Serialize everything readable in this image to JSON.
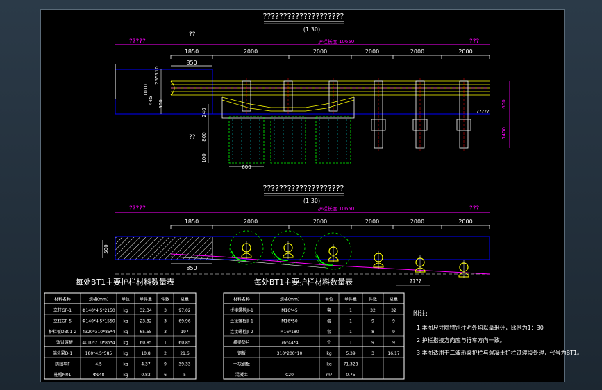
{
  "elevation": {
    "title": "????????????????????",
    "scale": "(1:30)",
    "section_mark_top": "??",
    "section_mark_bottom": "??",
    "left_label": "?????",
    "right_label": "???",
    "total_length": "护栏长度 10650",
    "spans": [
      "1850",
      "2000",
      "2000",
      "2000",
      "2000",
      "2000"
    ],
    "sub_dim": "850",
    "vert_dims": [
      "310",
      "255",
      "1010",
      "445",
      "500",
      "240",
      "800",
      "100"
    ],
    "footing_width": "600",
    "right_dims": [
      "600",
      "1400"
    ],
    "right_note": "?????"
  },
  "plan": {
    "title": "????????????????????",
    "scale": "(1:30)",
    "left_label": "?????",
    "right_label": "???",
    "total_length": "护栏长度 10650",
    "spans": [
      "1850",
      "2000",
      "2000",
      "2000",
      "2000",
      "2000"
    ],
    "sub_dim": "850",
    "height_dim": "500",
    "slope_label": "????"
  },
  "table_left": {
    "title": "每处BT1主要护栏材料数量表",
    "headers": [
      "材料名称",
      "规格(mm)",
      "单位",
      "单件重",
      "件数",
      "总重"
    ],
    "rows": [
      [
        "立柱GF-1",
        "Ф140*4.5*2150",
        "kg",
        "32.34",
        "3",
        "97.02"
      ],
      [
        "立柱GF-5",
        "Ф140*4.5*1550",
        "kg",
        "23.32",
        "3",
        "69.96"
      ],
      [
        "护栏板DB01-2",
        "4320*310*85*4",
        "kg",
        "65.55",
        "3",
        "197"
      ],
      [
        "二波过渡板",
        "4010*310*85*4",
        "kg",
        "60.85",
        "1",
        "60.85"
      ],
      [
        "端头梁D-1",
        "180*4.5*585",
        "kg",
        "10.8",
        "2",
        "21.6"
      ],
      [
        "防阻块F",
        "4.5",
        "kg",
        "4.37",
        "9",
        "39.33"
      ],
      [
        "柱帽M01",
        "Ф148",
        "kg",
        "0.83",
        "6",
        "5"
      ]
    ]
  },
  "table_right": {
    "title": "每处BT1主要护栏材料数量表",
    "headers": [
      "材料名称",
      "规格(mm)",
      "单位",
      "单件重",
      "件数",
      "总重"
    ],
    "rows": [
      [
        "拼接螺栓JI-1",
        "M16*45",
        "套",
        "1",
        "32",
        "32"
      ],
      [
        "连接螺栓JI-1",
        "M16*50",
        "套",
        "1",
        "9",
        "9"
      ],
      [
        "连接螺栓JI-2",
        "M16*180",
        "套",
        "1",
        "8",
        "9"
      ],
      [
        "横梁垫片",
        "76*44*4",
        "个",
        "1",
        "9",
        "9"
      ],
      [
        "钢板",
        "310*200*10",
        "kg",
        "5.39",
        "3",
        "16.17"
      ],
      [
        "一块钢板",
        "",
        "kg",
        "71.328",
        "",
        ""
      ],
      [
        "混凝土",
        "C20",
        "m³",
        "0.75",
        "",
        ""
      ]
    ]
  },
  "notes": {
    "heading": "附注:",
    "items": [
      "1.本图尺寸除特别注明外均以毫米计，比例为1：30",
      "2.护栏搭接方向应与行车方向一致。",
      "3.本图适用于二波形梁护栏与混凝土护栏过渡段处理，代号为BT1。"
    ]
  },
  "colors": {
    "background": "#000000",
    "magenta": "#ff00ff",
    "yellow": "#ffff00",
    "green": "#00ff00",
    "cyan": "#00ffff",
    "blue": "#0000ff",
    "white": "#ffffff",
    "red": "#ff0000"
  }
}
